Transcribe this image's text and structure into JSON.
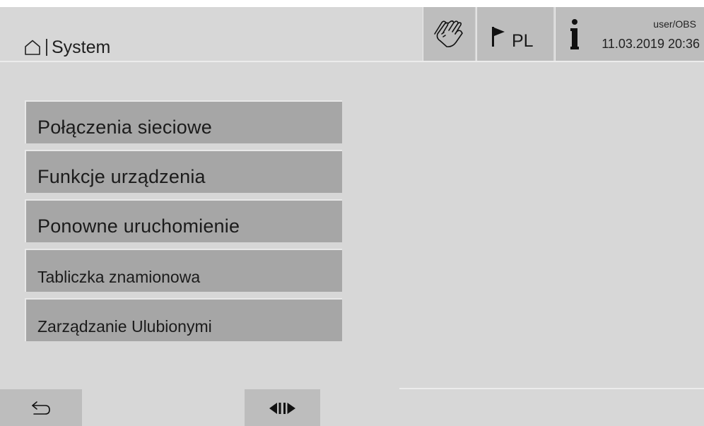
{
  "header": {
    "breadcrumb": {
      "home_icon": "home-icon",
      "title": "System"
    },
    "hand_button": {
      "icon": "hand-icon"
    },
    "language_button": {
      "icon": "flag-icon",
      "label": "PL"
    },
    "info_button": {
      "icon": "info-icon",
      "user": "user/OBS",
      "datetime": "11.03.2019 20:36"
    }
  },
  "menu": {
    "items": [
      {
        "label": "Połączenia sieciowe",
        "size": "large"
      },
      {
        "label": "Funkcje urządzenia",
        "size": "large"
      },
      {
        "label": "Ponowne uruchomienie",
        "size": "large"
      },
      {
        "label": "Tabliczka znamionowa",
        "size": "small"
      },
      {
        "label": "Zarządzanie Ulubionymi",
        "size": "small"
      }
    ]
  },
  "footer": {
    "back_button": {
      "icon": "back-arrow-icon"
    },
    "split_button": {
      "icon": "split-view-icon"
    }
  },
  "colors": {
    "background": "#d7d7d7",
    "button": "#a6a6a6",
    "header_button": "#bdbdbd",
    "divider": "#ececec"
  }
}
